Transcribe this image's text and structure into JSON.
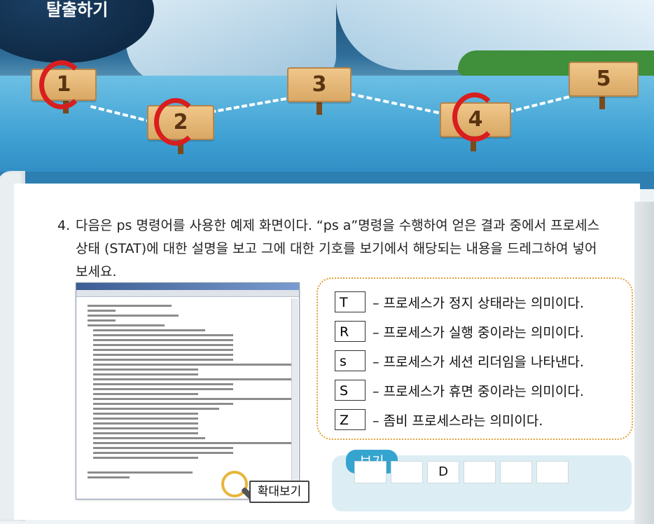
{
  "header": {
    "title": "탈출하기"
  },
  "signs": [
    "1",
    "2",
    "3",
    "4",
    "5"
  ],
  "question": {
    "number": "4.",
    "text": "다음은 ps 명령어를 사용한 예제 화면이다. “ps a”명령을 수행하여 얻은 결과 중에서 프로세스 상태 (STAT)에 대한 설명을 보고 그에 대한 기호를 보기에서 해당되는 내용을 드레그하여 넣어보세요."
  },
  "zoom_label": "확대보기",
  "answers": [
    {
      "symbol": "T",
      "text": "– 프로세스가 정지 상태라는 의미이다."
    },
    {
      "symbol": "R",
      "text": "– 프로세스가 실행 중이라는 의미이다."
    },
    {
      "symbol": "s",
      "text": "– 프로세스가 세션 리더임을 나타낸다."
    },
    {
      "symbol": "S",
      "text": "– 프로세스가 휴면 중이라는 의미이다."
    },
    {
      "symbol": "Z",
      "text": "– 좀비 프로세스라는 의미이다."
    }
  ],
  "choices": {
    "label": "보기",
    "items": [
      "",
      "",
      "D",
      "",
      "",
      ""
    ]
  },
  "colors": {
    "accent": "#35a4cf",
    "ring": "#d81e1e",
    "dotted_border": "#e2a23a"
  },
  "icons": {
    "zoom": "magnifier-icon"
  }
}
